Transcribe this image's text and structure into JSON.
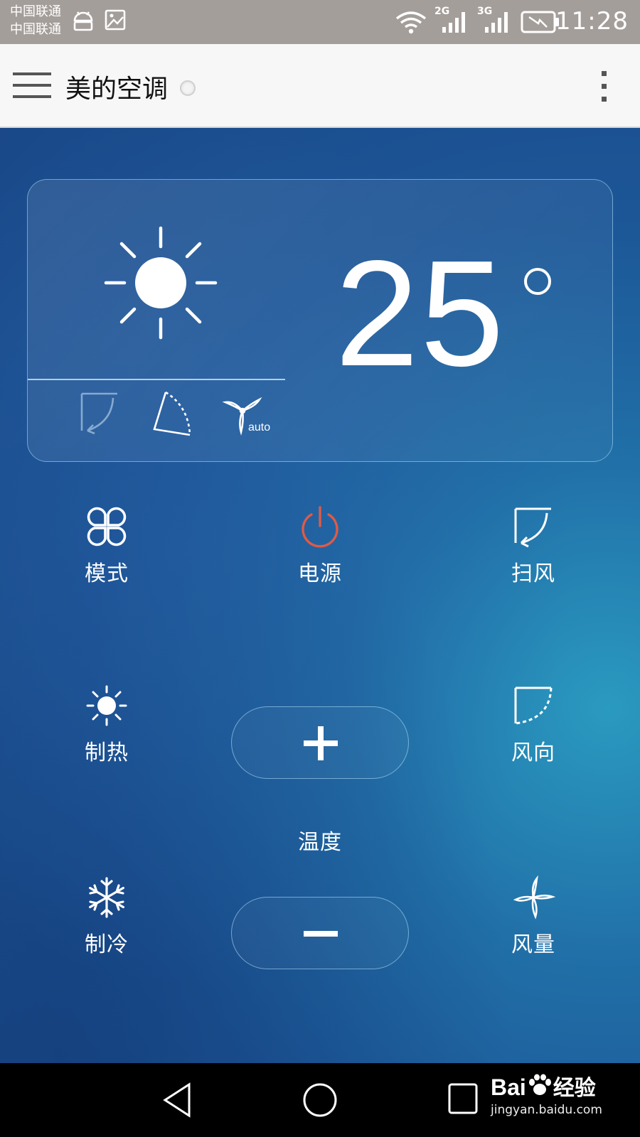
{
  "status_bar": {
    "carrier_1": "中国联通",
    "carrier_2": "中国联通",
    "network_1": "2G",
    "network_2": "3G",
    "time": "11:28"
  },
  "app_bar": {
    "title": "美的空调"
  },
  "display": {
    "temperature": "25",
    "mode_icon": "sun-icon",
    "fan_speed_label": "auto"
  },
  "controls": {
    "mode": "模式",
    "power": "电源",
    "sweep": "扫风",
    "heat": "制热",
    "direction": "风向",
    "cool": "制冷",
    "fan_speed": "风量",
    "temperature": "温度"
  },
  "watermark": {
    "brand": "Bai",
    "brand_suffix": "经验",
    "url": "jingyan.baidu.com"
  },
  "colors": {
    "power_accent": "#e05a45",
    "status_bar": "#a49e9a",
    "app_bar": "#f7f7f7"
  }
}
